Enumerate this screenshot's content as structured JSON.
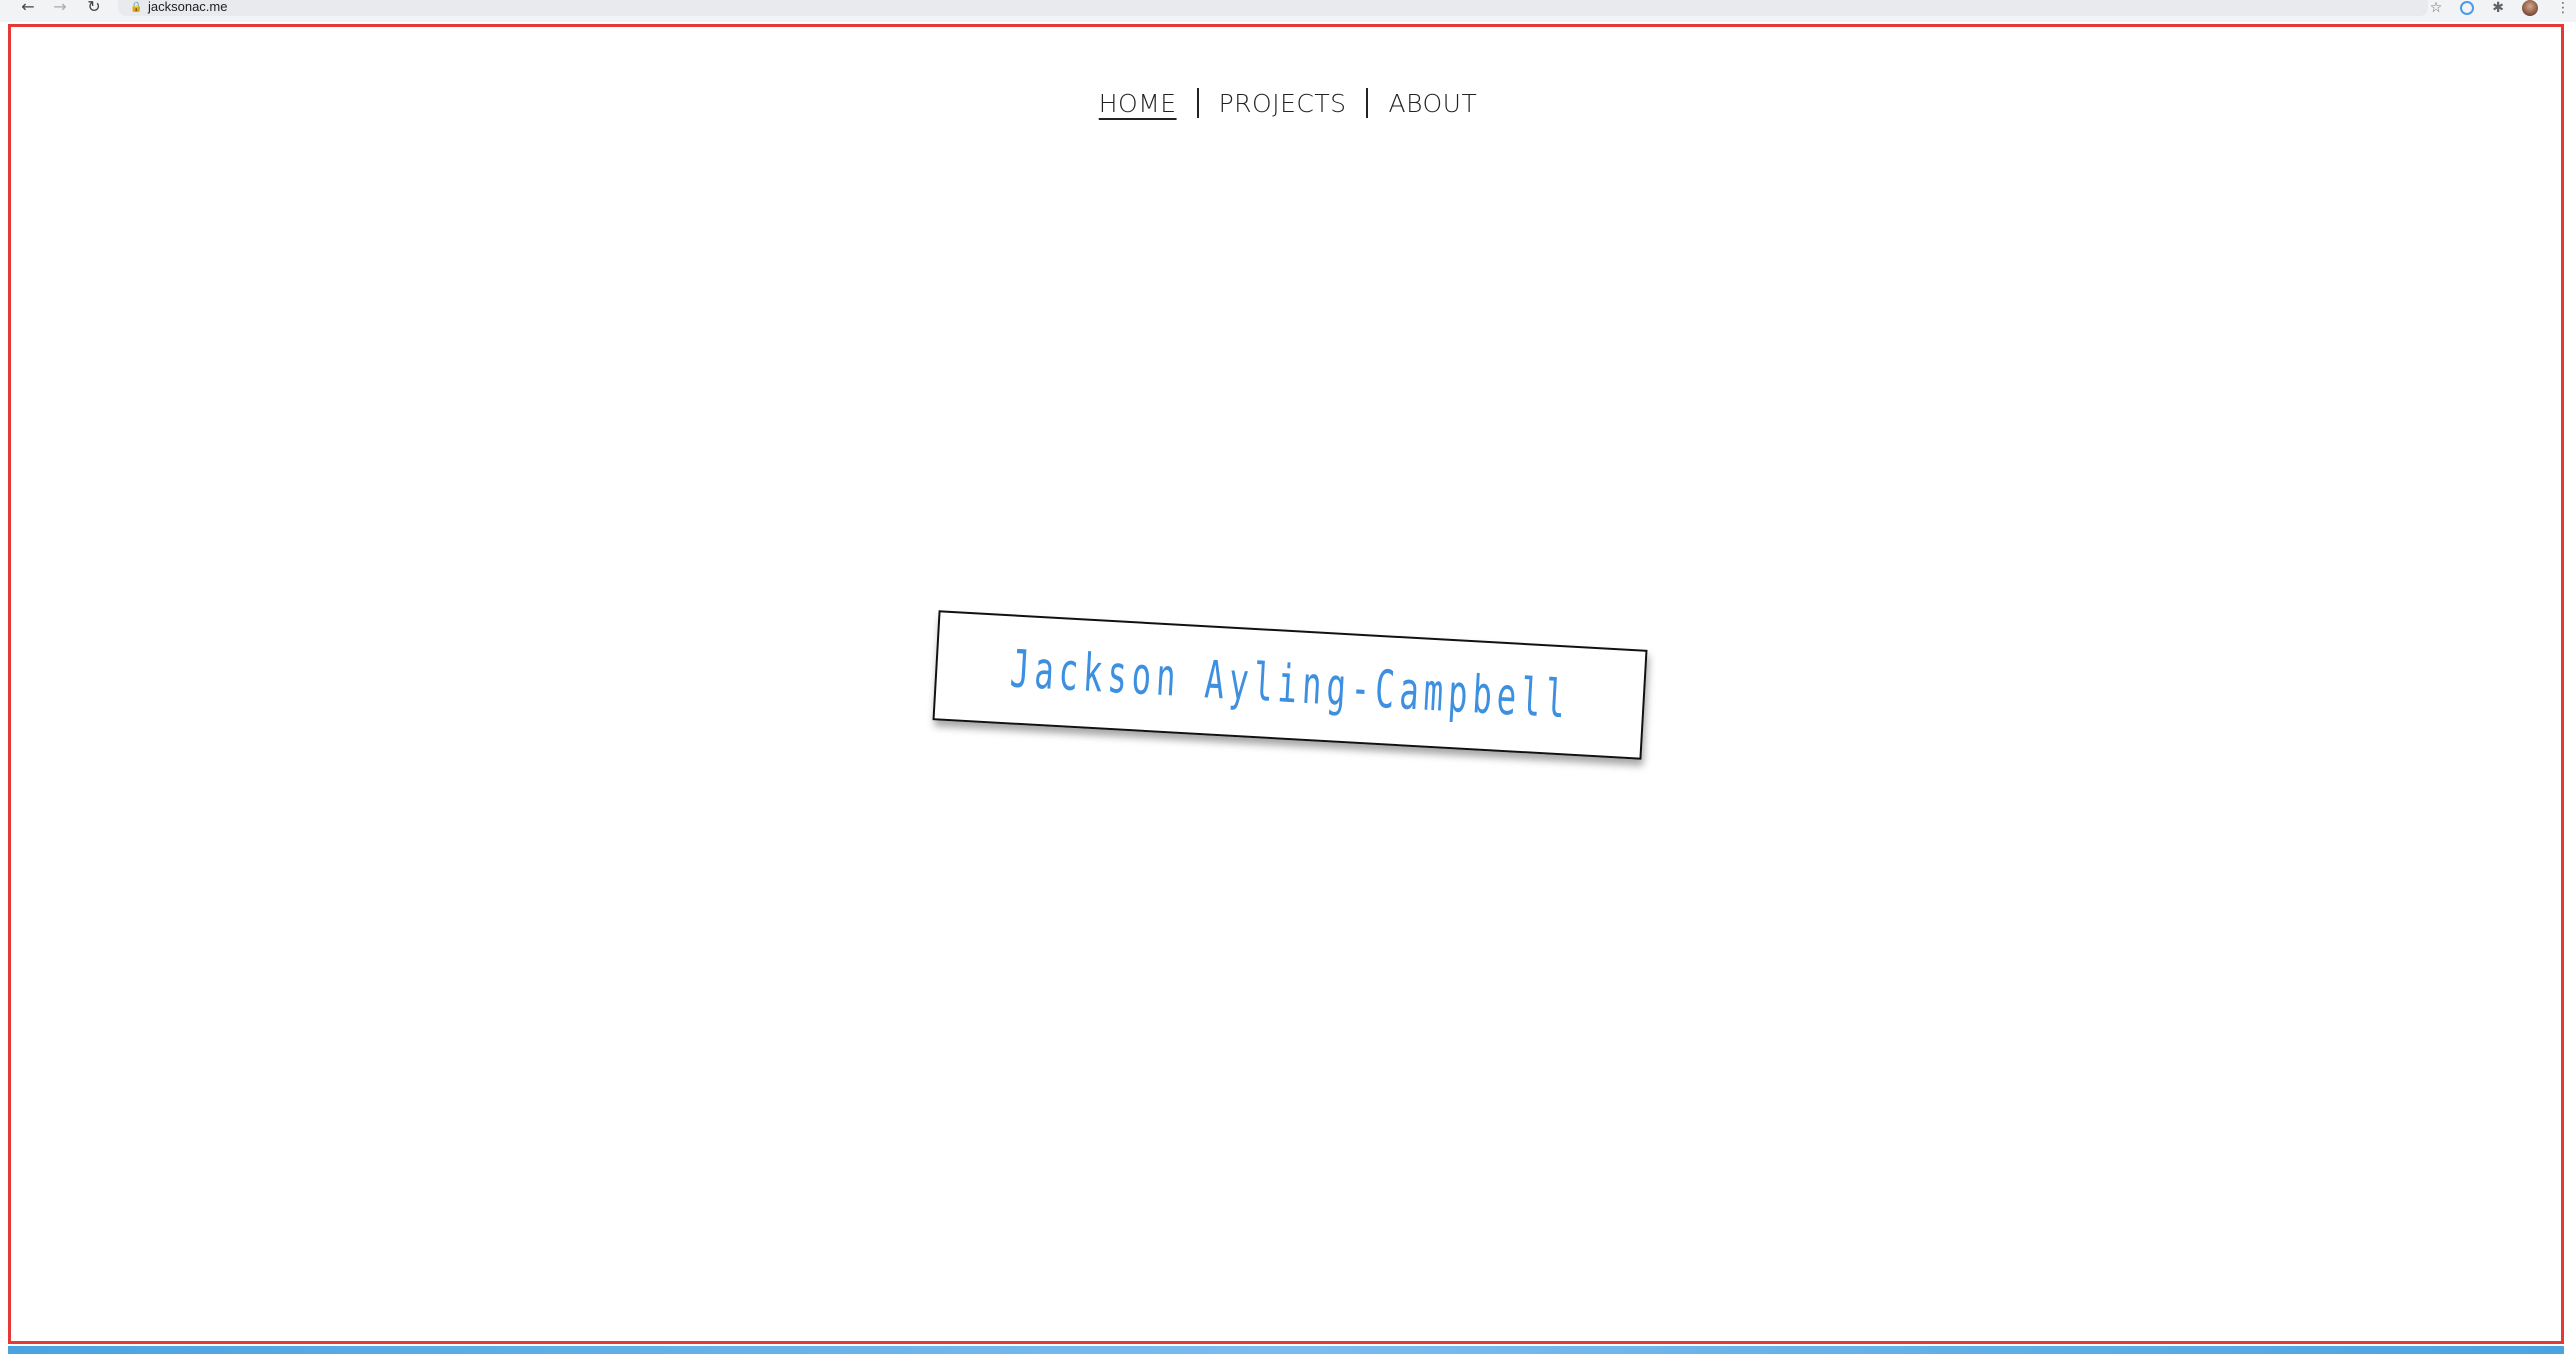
{
  "browser": {
    "url": "jacksonac.me",
    "back_icon": "arrow-left-icon",
    "forward_icon": "arrow-right-icon",
    "reload_icon": "reload-icon"
  },
  "nav": {
    "items": [
      {
        "label": "HOME",
        "active": true
      },
      {
        "label": "PROJECTS",
        "active": false
      },
      {
        "label": "ABOUT",
        "active": false
      }
    ]
  },
  "hero": {
    "name": "Jackson Ayling-Campbell"
  },
  "colors": {
    "accent": "#3d8fe0",
    "frame": "#e53935"
  }
}
